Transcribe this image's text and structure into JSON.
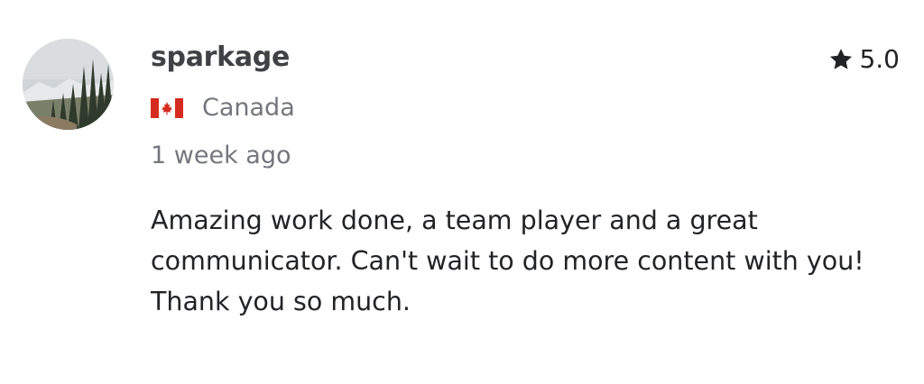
{
  "review": {
    "username": "sparkage",
    "country": "Canada",
    "flag_icon": "canada-flag-icon",
    "time_ago": "1 week ago",
    "rating": "5.0",
    "rating_icon": "star-icon",
    "text": "Amazing work done, a team player and a great communicator. Can't wait to do more content with you! Thank you so much."
  },
  "colors": {
    "primary_text": "#222325",
    "secondary_text": "#74767e",
    "flag_red": "#d52b1e"
  }
}
